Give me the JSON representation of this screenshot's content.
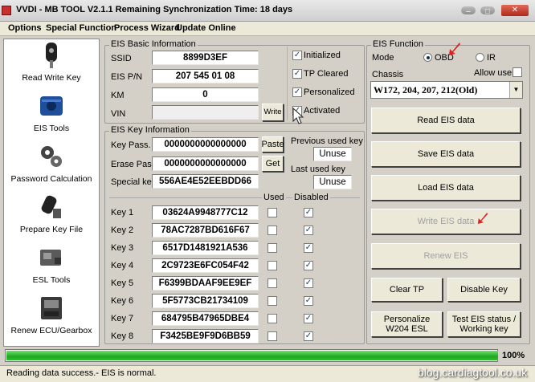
{
  "window": {
    "title": "VVDI - MB TOOL V2.1.1    Remaining Synchronization Time: 18 days"
  },
  "menu": [
    "Options",
    "Special Function",
    "Process Wizard",
    "Update Online"
  ],
  "sidebar": [
    {
      "label": "Read Write Key",
      "icon": "car-key-icon"
    },
    {
      "label": "EIS Tools",
      "icon": "eis-module-icon"
    },
    {
      "label": "Password Calculation",
      "icon": "gears-icon"
    },
    {
      "label": "Prepare Key File",
      "icon": "key-file-icon"
    },
    {
      "label": "ESL Tools",
      "icon": "esl-module-icon"
    },
    {
      "label": "Renew ECU/Gearbox",
      "icon": "ecu-icon"
    }
  ],
  "eis_basic": {
    "title": "EIS Basic Information",
    "ssid_label": "SSID",
    "ssid": "8899D3EF",
    "pn_label": "EIS P/N",
    "pn": "207 545 01 08",
    "km_label": "KM",
    "km": "0",
    "vin_label": "VIN",
    "vin": "",
    "write_label": "Write",
    "checks": [
      {
        "label": "Initialized",
        "checked": true
      },
      {
        "label": "TP Cleared",
        "checked": true
      },
      {
        "label": "Personalized",
        "checked": true
      },
      {
        "label": "Activated",
        "checked": true
      }
    ]
  },
  "eis_key": {
    "title": "EIS Key Information",
    "keypass_label": "Key Pass.",
    "keypass": "0000000000000000",
    "paste_label": "Paste",
    "erase_label": "Erase Pass.",
    "erase": "0000000000000000",
    "get_label": "Get",
    "special_label": "Special key",
    "special": "556AE4E52EEBDD66",
    "prev_label": "Previous used key",
    "prev": "Unuse",
    "last_label": "Last used key",
    "last": "Unuse",
    "used_header": "Used",
    "disabled_header": "Disabled",
    "keys": [
      {
        "label": "Key 1",
        "value": "03624A9948777C12",
        "used": false,
        "disabled": true
      },
      {
        "label": "Key 2",
        "value": "78AC7287BD616F67",
        "used": false,
        "disabled": true
      },
      {
        "label": "Key 3",
        "value": "6517D1481921A536",
        "used": false,
        "disabled": true
      },
      {
        "label": "Key 4",
        "value": "2C9723E6FC054F42",
        "used": false,
        "disabled": true
      },
      {
        "label": "Key 5",
        "value": "F6399BDAAF9EE9EF",
        "used": false,
        "disabled": true
      },
      {
        "label": "Key 6",
        "value": "5F5773CB21734109",
        "used": false,
        "disabled": true
      },
      {
        "label": "Key 7",
        "value": "684795B47965DBE4",
        "used": false,
        "disabled": true
      },
      {
        "label": "Key 8",
        "value": "F3425BE9F9D6BB59",
        "used": false,
        "disabled": true
      }
    ]
  },
  "eis_function": {
    "title": "EIS Function",
    "mode_label": "Mode",
    "mode_obd": "OBD",
    "mode_ir": "IR",
    "mode_selected": "OBD",
    "chassis_label": "Chassis",
    "allow_user_label": "Allow user",
    "chassis_value": "W172, 204, 207, 212(Old)",
    "buttons": {
      "read": "Read EIS data",
      "save": "Save EIS data",
      "load": "Load EIS data",
      "write": "Write EIS data",
      "renew": "Renew EIS",
      "clear_tp": "Clear TP",
      "disable_key": "Disable Key",
      "personalize": "Personalize W204 ESL",
      "test": "Test EIS status / Working key"
    }
  },
  "progress": {
    "value": 1.0,
    "label": "100%"
  },
  "status": {
    "text": "Reading data success.- EIS is normal."
  },
  "watermark": "blog.cardiagtool.co.uk",
  "colors": {
    "progress": "#2fbf2f",
    "accent_arrow": "#e02020",
    "field_bg": "#ffffff"
  }
}
